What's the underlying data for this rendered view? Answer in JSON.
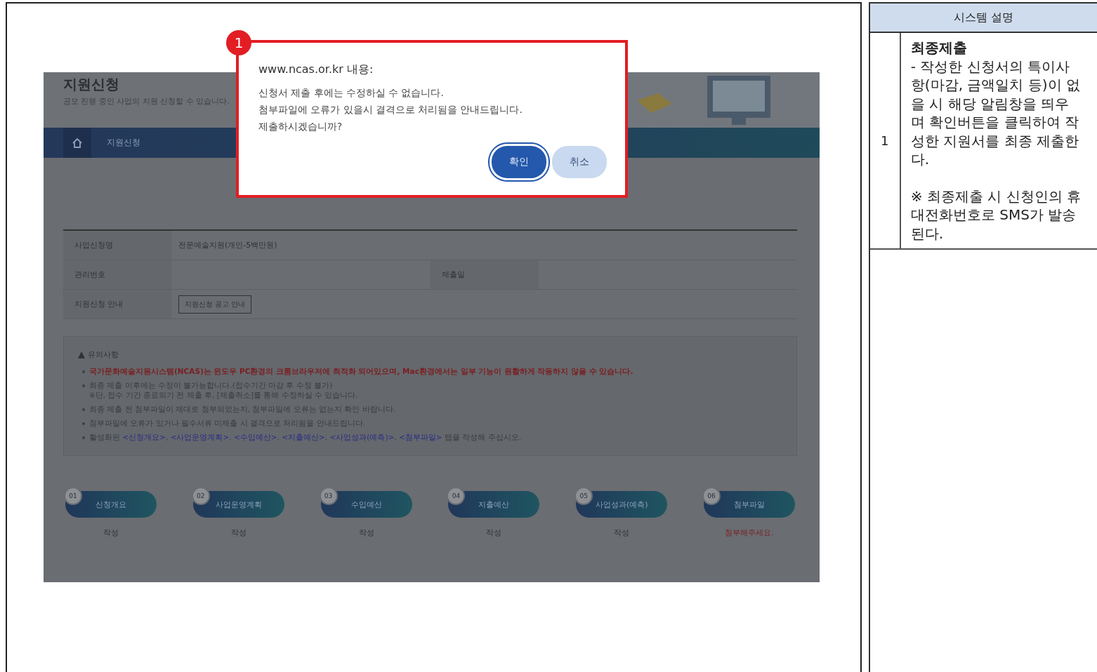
{
  "screen": {
    "page_title": "지원신청",
    "page_subtitle": "공모 진행 중인 사업의 지원 신청할 수 있습니다.",
    "breadcrumb": "지원신청",
    "info_table": [
      {
        "label": "사업신청명",
        "value": "전문예술지원(개인-5백만원)"
      },
      {
        "label": "관리번호",
        "label_2": "제출일"
      },
      {
        "label": "지원신청 안내",
        "button": "지원신청 공고 안내"
      }
    ],
    "notes": {
      "title": "유의사항",
      "items": [
        {
          "kind": "warning",
          "text": "국가문화예술지원시스템(NCAS)는 윈도우 PC환경의 크롬브라우저에 최적화 되어있으며, Mac환경에서는 일부 기능이 원활하게 작동하지 않을 수 있습니다."
        },
        {
          "kind": "normal",
          "text": "최종 제출 이후에는 수정이 불가능합니다.(접수기간 마감 후 수정 불가)",
          "sub": "※단, 접수 기간 종료되기 전 제출 후, [제출취소]를 통해 수정하실 수 있습니다."
        },
        {
          "kind": "normal",
          "text": "최종 제출 전 첨부파일이 제대로 첨부되었는지, 첨부파일에 오류는 없는지 확인 바랍니다."
        },
        {
          "kind": "normal",
          "text": "첨부파일에 오류가 있거나 필수서류 미제출 시 결격으로 처리됨을 안내드립니다."
        },
        {
          "kind": "tabs",
          "text": "활성화된",
          "separator": ",",
          "links": [
            "<신청개요>",
            "<사업운영계획>",
            "<수입예산>",
            "<지출예산>",
            "<사업성과(예측)>",
            "<첨부파일>"
          ],
          "tail": "탭을 작성해 주십시오."
        }
      ]
    },
    "steps": [
      {
        "number": "01",
        "label": "신청개요",
        "status": "작성",
        "warning": false
      },
      {
        "number": "02",
        "label": "사업운영계획",
        "status": "작성",
        "warning": false
      },
      {
        "number": "03",
        "label": "수입예산",
        "status": "작성",
        "warning": false
      },
      {
        "number": "04",
        "label": "지출예산",
        "status": "작성",
        "warning": false
      },
      {
        "number": "05",
        "label": "사업성과(예측)",
        "status": "작성",
        "warning": false
      },
      {
        "number": "06",
        "label": "첨부파일",
        "status": "첨부해주세요.",
        "warning": true
      }
    ]
  },
  "dialog": {
    "callout": "1",
    "title": "www.ncas.or.kr 내용:",
    "message": [
      "신청서 제출 후에는 수정하실 수 없습니다.",
      "첨부파일에 오류가 있을시 결격으로 처리됨을 안내드립니다.",
      "제출하시겠습니까?"
    ],
    "buttons": [
      {
        "label": "확인",
        "focused": true
      },
      {
        "label": "취소",
        "focused": false
      }
    ]
  },
  "description": {
    "header": "시스템 설명",
    "rows": [
      {
        "number": "1",
        "title": "최종제출",
        "text": "- 작성한 신청서의 특이사항(마감, 금액일치 등)이 없을 시 해당 알림창을 띄우며 확인버튼을 클릭하여 작성한 지원서를 최종 제출한다.",
        "note": "※ 최종제출 시 신청인의 휴대전화번호로 SMS가 발송된다."
      }
    ]
  }
}
